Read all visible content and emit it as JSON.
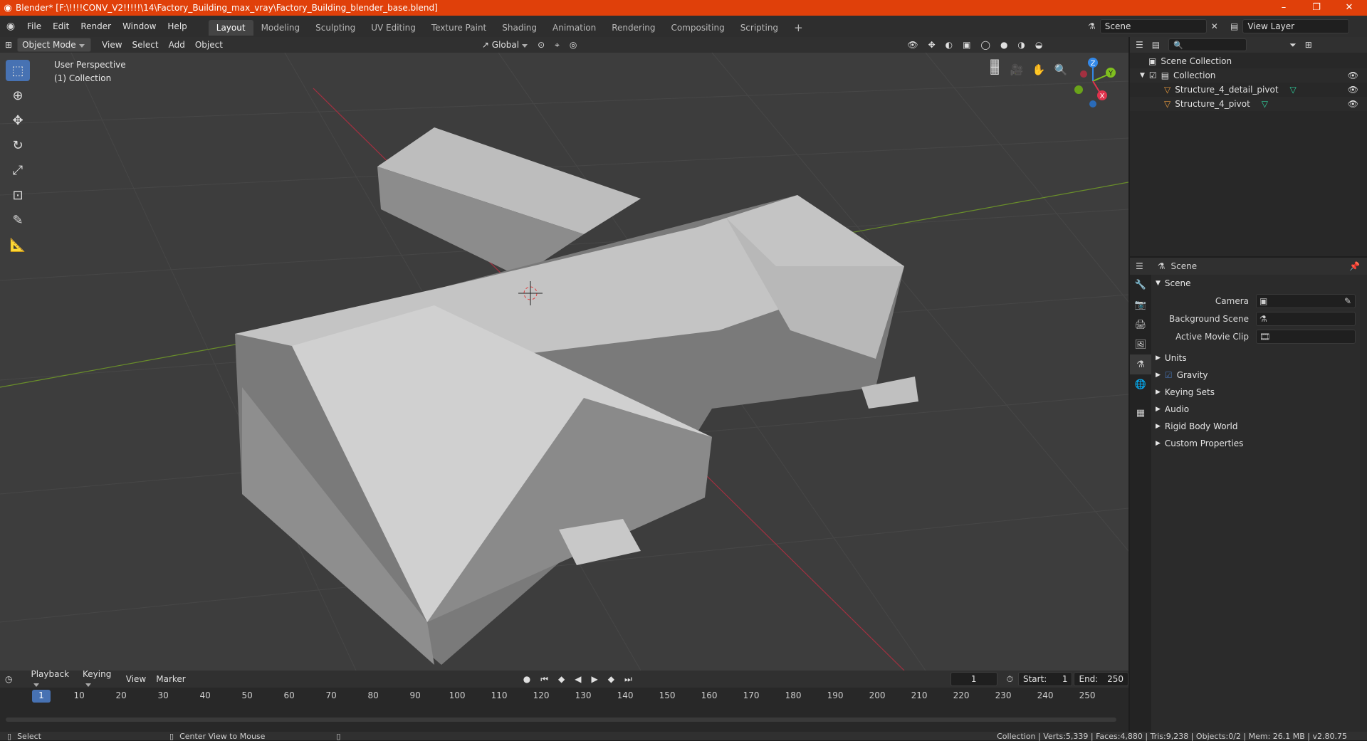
{
  "window": {
    "title": "Blender* [F:\\!!!!CONV_V2!!!!!\\14\\Factory_Building_max_vray\\Factory_Building_blender_base.blend]",
    "minimize": "–",
    "maximize": "❐",
    "close": "✕"
  },
  "menus": [
    "File",
    "Edit",
    "Render",
    "Window",
    "Help"
  ],
  "workspaces": [
    "Layout",
    "Modeling",
    "Sculpting",
    "UV Editing",
    "Texture Paint",
    "Shading",
    "Animation",
    "Rendering",
    "Compositing",
    "Scripting"
  ],
  "workspace_add": "+",
  "scene_field": "Scene",
  "view_layer_field": "View Layer",
  "viewport_header": {
    "mode": "Object Mode",
    "menus": [
      "View",
      "Select",
      "Add",
      "Object"
    ],
    "transform": "Global"
  },
  "viewport": {
    "perspective": "User Perspective",
    "collection": "(1) Collection",
    "axes": {
      "x": "X",
      "y": "Y",
      "z": "Z"
    }
  },
  "outliner": {
    "root": "Scene Collection",
    "collection": "Collection",
    "objects": [
      "Structure_4_detail_pivot",
      "Structure_4_pivot"
    ]
  },
  "properties": {
    "header": "Scene",
    "panel": "Scene",
    "fields": [
      {
        "label": "Camera"
      },
      {
        "label": "Background Scene"
      },
      {
        "label": "Active Movie Clip"
      }
    ],
    "sections": [
      "Units",
      "Gravity",
      "Keying Sets",
      "Audio",
      "Rigid Body World",
      "Custom Properties"
    ]
  },
  "timeline": {
    "menus": [
      "Playback",
      "Keying",
      "View",
      "Marker"
    ],
    "current_frame": "1",
    "start_label": "Start:",
    "start": "1",
    "end_label": "End:",
    "end": "250",
    "ticks": [
      "1",
      "10",
      "20",
      "30",
      "40",
      "50",
      "60",
      "70",
      "80",
      "90",
      "100",
      "110",
      "120",
      "130",
      "140",
      "150",
      "160",
      "170",
      "180",
      "190",
      "200",
      "210",
      "220",
      "230",
      "240",
      "250"
    ]
  },
  "status": {
    "left": "Select",
    "middle": "Center View to Mouse",
    "right": "Collection | Verts:5,339 | Faces:4,880 | Tris:9,238 | Objects:0/2 | Mem: 26.1 MB | v2.80.75"
  },
  "colors": {
    "accent": "#4772b3",
    "titlebar": "#e0400a",
    "x_axis": "#e0334d",
    "y_axis": "#7fbf1f",
    "z_axis": "#3388e8"
  }
}
